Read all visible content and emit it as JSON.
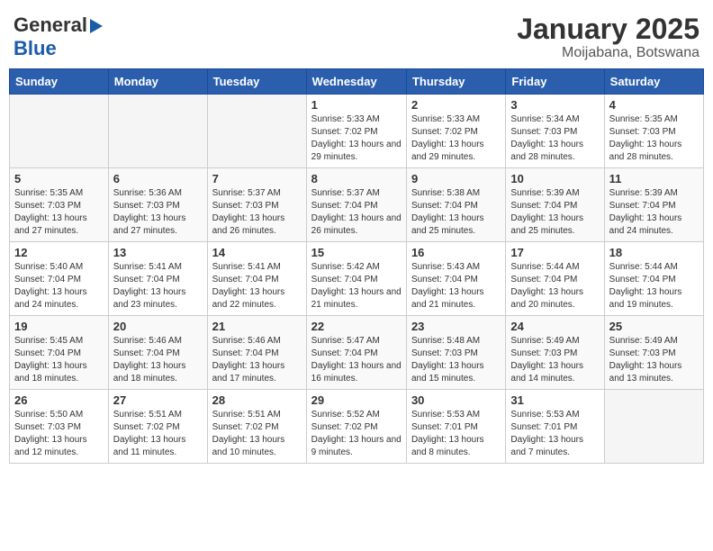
{
  "header": {
    "logo_general": "General",
    "logo_blue": "Blue",
    "month_title": "January 2025",
    "location": "Moijabana, Botswana"
  },
  "weekdays": [
    "Sunday",
    "Monday",
    "Tuesday",
    "Wednesday",
    "Thursday",
    "Friday",
    "Saturday"
  ],
  "weeks": [
    [
      {
        "day": "",
        "info": ""
      },
      {
        "day": "",
        "info": ""
      },
      {
        "day": "",
        "info": ""
      },
      {
        "day": "1",
        "info": "Sunrise: 5:33 AM\nSunset: 7:02 PM\nDaylight: 13 hours\nand 29 minutes."
      },
      {
        "day": "2",
        "info": "Sunrise: 5:33 AM\nSunset: 7:02 PM\nDaylight: 13 hours\nand 29 minutes."
      },
      {
        "day": "3",
        "info": "Sunrise: 5:34 AM\nSunset: 7:03 PM\nDaylight: 13 hours\nand 28 minutes."
      },
      {
        "day": "4",
        "info": "Sunrise: 5:35 AM\nSunset: 7:03 PM\nDaylight: 13 hours\nand 28 minutes."
      }
    ],
    [
      {
        "day": "5",
        "info": "Sunrise: 5:35 AM\nSunset: 7:03 PM\nDaylight: 13 hours\nand 27 minutes."
      },
      {
        "day": "6",
        "info": "Sunrise: 5:36 AM\nSunset: 7:03 PM\nDaylight: 13 hours\nand 27 minutes."
      },
      {
        "day": "7",
        "info": "Sunrise: 5:37 AM\nSunset: 7:03 PM\nDaylight: 13 hours\nand 26 minutes."
      },
      {
        "day": "8",
        "info": "Sunrise: 5:37 AM\nSunset: 7:04 PM\nDaylight: 13 hours\nand 26 minutes."
      },
      {
        "day": "9",
        "info": "Sunrise: 5:38 AM\nSunset: 7:04 PM\nDaylight: 13 hours\nand 25 minutes."
      },
      {
        "day": "10",
        "info": "Sunrise: 5:39 AM\nSunset: 7:04 PM\nDaylight: 13 hours\nand 25 minutes."
      },
      {
        "day": "11",
        "info": "Sunrise: 5:39 AM\nSunset: 7:04 PM\nDaylight: 13 hours\nand 24 minutes."
      }
    ],
    [
      {
        "day": "12",
        "info": "Sunrise: 5:40 AM\nSunset: 7:04 PM\nDaylight: 13 hours\nand 24 minutes."
      },
      {
        "day": "13",
        "info": "Sunrise: 5:41 AM\nSunset: 7:04 PM\nDaylight: 13 hours\nand 23 minutes."
      },
      {
        "day": "14",
        "info": "Sunrise: 5:41 AM\nSunset: 7:04 PM\nDaylight: 13 hours\nand 22 minutes."
      },
      {
        "day": "15",
        "info": "Sunrise: 5:42 AM\nSunset: 7:04 PM\nDaylight: 13 hours\nand 21 minutes."
      },
      {
        "day": "16",
        "info": "Sunrise: 5:43 AM\nSunset: 7:04 PM\nDaylight: 13 hours\nand 21 minutes."
      },
      {
        "day": "17",
        "info": "Sunrise: 5:44 AM\nSunset: 7:04 PM\nDaylight: 13 hours\nand 20 minutes."
      },
      {
        "day": "18",
        "info": "Sunrise: 5:44 AM\nSunset: 7:04 PM\nDaylight: 13 hours\nand 19 minutes."
      }
    ],
    [
      {
        "day": "19",
        "info": "Sunrise: 5:45 AM\nSunset: 7:04 PM\nDaylight: 13 hours\nand 18 minutes."
      },
      {
        "day": "20",
        "info": "Sunrise: 5:46 AM\nSunset: 7:04 PM\nDaylight: 13 hours\nand 18 minutes."
      },
      {
        "day": "21",
        "info": "Sunrise: 5:46 AM\nSunset: 7:04 PM\nDaylight: 13 hours\nand 17 minutes."
      },
      {
        "day": "22",
        "info": "Sunrise: 5:47 AM\nSunset: 7:04 PM\nDaylight: 13 hours\nand 16 minutes."
      },
      {
        "day": "23",
        "info": "Sunrise: 5:48 AM\nSunset: 7:03 PM\nDaylight: 13 hours\nand 15 minutes."
      },
      {
        "day": "24",
        "info": "Sunrise: 5:49 AM\nSunset: 7:03 PM\nDaylight: 13 hours\nand 14 minutes."
      },
      {
        "day": "25",
        "info": "Sunrise: 5:49 AM\nSunset: 7:03 PM\nDaylight: 13 hours\nand 13 minutes."
      }
    ],
    [
      {
        "day": "26",
        "info": "Sunrise: 5:50 AM\nSunset: 7:03 PM\nDaylight: 13 hours\nand 12 minutes."
      },
      {
        "day": "27",
        "info": "Sunrise: 5:51 AM\nSunset: 7:02 PM\nDaylight: 13 hours\nand 11 minutes."
      },
      {
        "day": "28",
        "info": "Sunrise: 5:51 AM\nSunset: 7:02 PM\nDaylight: 13 hours\nand 10 minutes."
      },
      {
        "day": "29",
        "info": "Sunrise: 5:52 AM\nSunset: 7:02 PM\nDaylight: 13 hours\nand 9 minutes."
      },
      {
        "day": "30",
        "info": "Sunrise: 5:53 AM\nSunset: 7:01 PM\nDaylight: 13 hours\nand 8 minutes."
      },
      {
        "day": "31",
        "info": "Sunrise: 5:53 AM\nSunset: 7:01 PM\nDaylight: 13 hours\nand 7 minutes."
      },
      {
        "day": "",
        "info": ""
      }
    ]
  ]
}
